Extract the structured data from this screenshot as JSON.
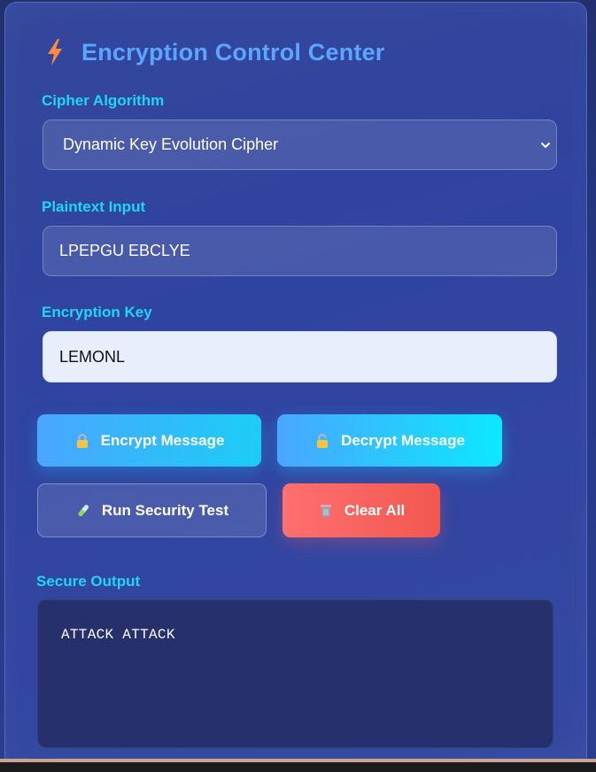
{
  "header": {
    "title": "Encryption Control Center",
    "icon": "lightning-bolt-icon"
  },
  "cipher": {
    "label": "Cipher Algorithm",
    "selected": "Dynamic Key Evolution Cipher"
  },
  "plaintext": {
    "label": "Plaintext Input",
    "value": "LPEPGU EBCLYE"
  },
  "key": {
    "label": "Encryption Key",
    "value": "LEMONL"
  },
  "buttons": {
    "encrypt": "Encrypt Message",
    "decrypt": "Decrypt Message",
    "test": "Run Security Test",
    "clear": "Clear All"
  },
  "output": {
    "label": "Secure Output",
    "text": "ATTACK ATTACK"
  },
  "colors": {
    "accent_title": "#5aa6ff",
    "label_cyan": "#1fd6f4",
    "clear_red": "#f2574f",
    "bolt_orange": "#ff8a3d"
  }
}
